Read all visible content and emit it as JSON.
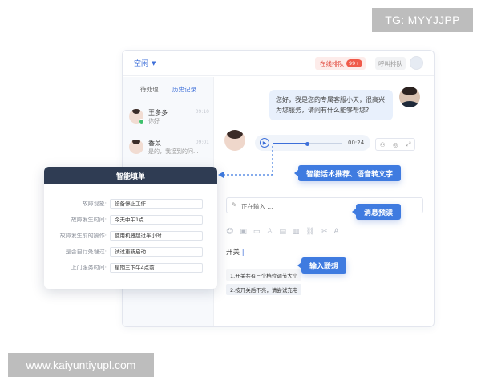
{
  "watermark": {
    "top": "TG: MYYJJPP",
    "bottom": "www.kaiyuntiyupl.com"
  },
  "topbar": {
    "status": "空闲",
    "queue_label": "在线排队",
    "queue_count": "99+",
    "call_queue_label": "呼叫排队"
  },
  "sidebar": {
    "tabs": [
      "待处理",
      "历史记录"
    ],
    "active_tab": "历史记录",
    "conversations": [
      {
        "name": "王多多",
        "message": "你好",
        "time": "09:10"
      },
      {
        "name": "香菜",
        "message": "是的，我接到的问...",
        "time": "09:01"
      }
    ]
  },
  "chat": {
    "agent_message": "您好，我是您的专属客服小天，很高兴为您服务，请问有什么能够帮您?",
    "voice_duration": "00:24",
    "voice_progress": 0.5,
    "typing_status": "正在输入 ...",
    "compose_text": "开关",
    "suggestions": [
      "1.开关共有三个档位调节大小",
      "2.按开关后不亮，请尝试充电"
    ]
  },
  "callouts": {
    "speech": "智能话术推荐、语音转文字",
    "preview": "消息预读",
    "association": "输入联想"
  },
  "smart_form": {
    "title": "智能填单",
    "fields": [
      {
        "label": "故障现象:",
        "value": "设备停止工作"
      },
      {
        "label": "故障发生时间:",
        "value": "今天中午1点"
      },
      {
        "label": "故障发生前的操作:",
        "value": "使用机器超过半小时"
      },
      {
        "label": "是否自行处理过:",
        "value": "试过重新启动"
      },
      {
        "label": "上门服务时间:",
        "value": "星期三下午4点前"
      }
    ]
  },
  "colors": {
    "accent": "#3f7be0",
    "header_dark": "#2f3c53",
    "badge_red": "#f05a4a",
    "online_green": "#3ec16d"
  }
}
